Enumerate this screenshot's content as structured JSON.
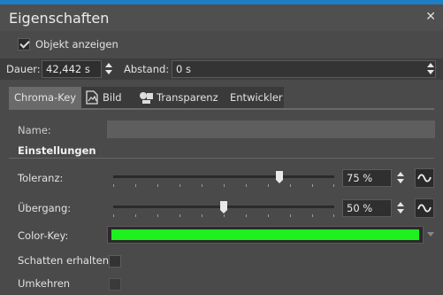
{
  "window": {
    "title": "Eigenschaften",
    "close_glyph": "✕"
  },
  "show_object": {
    "label": "Objekt anzeigen",
    "checked": true
  },
  "duration": {
    "label": "Dauer:",
    "value": "42,442 s"
  },
  "distance": {
    "label": "Abstand:",
    "value": "0 s"
  },
  "tabs": [
    {
      "label": "Chroma-Key",
      "active": true
    },
    {
      "label": "Bild",
      "icon": "image-icon"
    },
    {
      "label": "Transparenz",
      "icon": "transparency-icon"
    },
    {
      "label": "Entwickler"
    }
  ],
  "name": {
    "label": "Name:",
    "value": ""
  },
  "settings_heading": "Einstellungen",
  "tolerance": {
    "label": "Toleranz:",
    "value": "75 %",
    "level_percent": 75
  },
  "transition": {
    "label": "Übergang:",
    "value": "50 %",
    "level_percent": 50
  },
  "color_key": {
    "label": "Color-Key:",
    "color": "#1ef01e"
  },
  "keep_shadows": {
    "label": "Schatten erhalten",
    "checked": false
  },
  "invert": {
    "label": "Umkehren",
    "checked": false
  },
  "colors": {
    "accent": "#1e7fc6",
    "panel_bg": "#4a4a4a"
  }
}
